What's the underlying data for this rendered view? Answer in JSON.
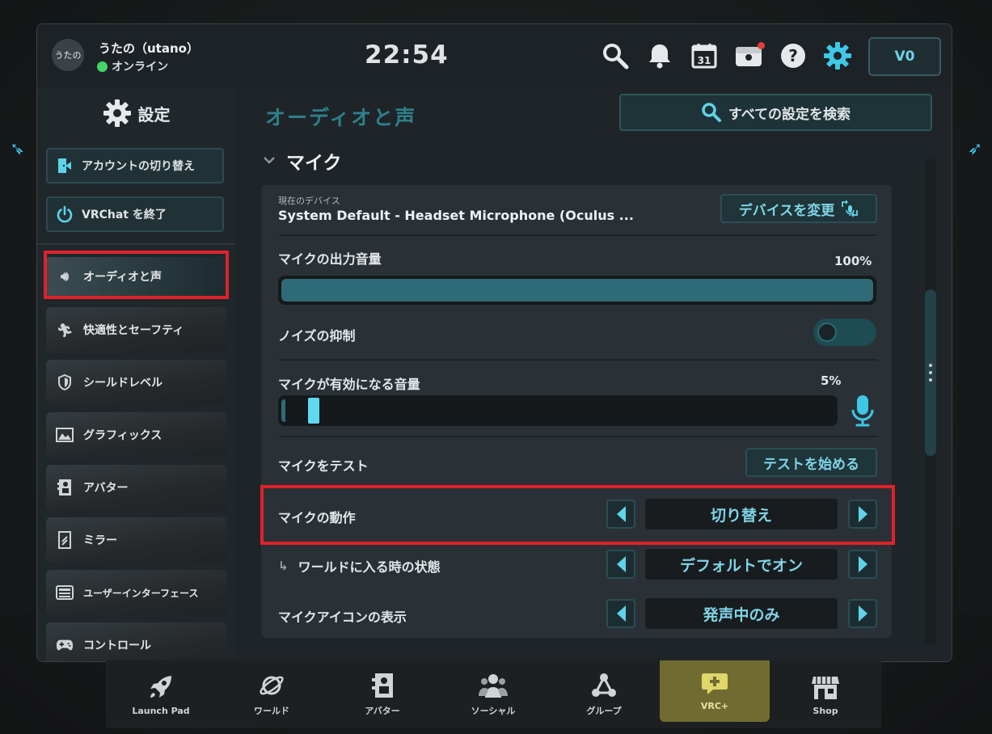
{
  "header": {
    "avatar_text": "うたの",
    "username": "うたの（utano）",
    "status": "オンライン",
    "clock": "22:54",
    "currency": "V0",
    "colors": {
      "online": "#45d46b",
      "notification": "#e53b3b",
      "accent": "#3ec7e6"
    }
  },
  "sidebar": {
    "title": "設定",
    "switch_account": "アカウントの切り替え",
    "quit": "VRChat を終了",
    "items": [
      {
        "label": "オーディオと声",
        "icon": "speaker-icon"
      },
      {
        "label": "快適性とセーフティ",
        "icon": "running-person-icon"
      },
      {
        "label": "シールドレベル",
        "icon": "shield-icon"
      },
      {
        "label": "グラフィックス",
        "icon": "image-icon"
      },
      {
        "label": "アバター",
        "icon": "avatar-icon"
      },
      {
        "label": "ミラー",
        "icon": "mirror-icon"
      },
      {
        "label": "ユーザーインターフェース",
        "icon": "keyboard-icon"
      },
      {
        "label": "コントロール",
        "icon": "gamepad-icon"
      }
    ]
  },
  "main": {
    "title": "オーディオと声",
    "search_all": "すべての設定を検索",
    "section": "マイク",
    "current_device_label": "現在のデバイス",
    "current_device": "System Default - Headset Microphone (Oculus ...",
    "change_device": "デバイスを変更",
    "mic_volume_label": "マイクの出力音量",
    "mic_volume_value": "100%",
    "mic_volume_fraction": 1.0,
    "noise_suppression_label": "ノイズの抑制",
    "noise_suppression_on": false,
    "activation_label": "マイクが有効になる音量",
    "activation_value": "5%",
    "activation_fraction": 0.05,
    "test_label": "マイクをテスト",
    "test_button": "テストを始める",
    "mic_behavior_label": "マイクの動作",
    "mic_behavior_value": "切り替え",
    "world_join_label": "ワールドに入る時の状態",
    "world_join_value": "デフォルトでオン",
    "mic_icon_label": "マイクアイコンの表示",
    "mic_icon_value": "発声中のみ"
  },
  "bottom_tabs": [
    {
      "label": "Launch Pad",
      "icon": "rocket-icon"
    },
    {
      "label": "ワールド",
      "icon": "planet-icon"
    },
    {
      "label": "アバター",
      "icon": "avatar-icon"
    },
    {
      "label": "ソーシャル",
      "icon": "people-icon"
    },
    {
      "label": "グループ",
      "icon": "group-icon"
    },
    {
      "label": "VRC+",
      "icon": "vrc-plus-icon"
    },
    {
      "label": "Shop",
      "icon": "shop-icon"
    }
  ]
}
